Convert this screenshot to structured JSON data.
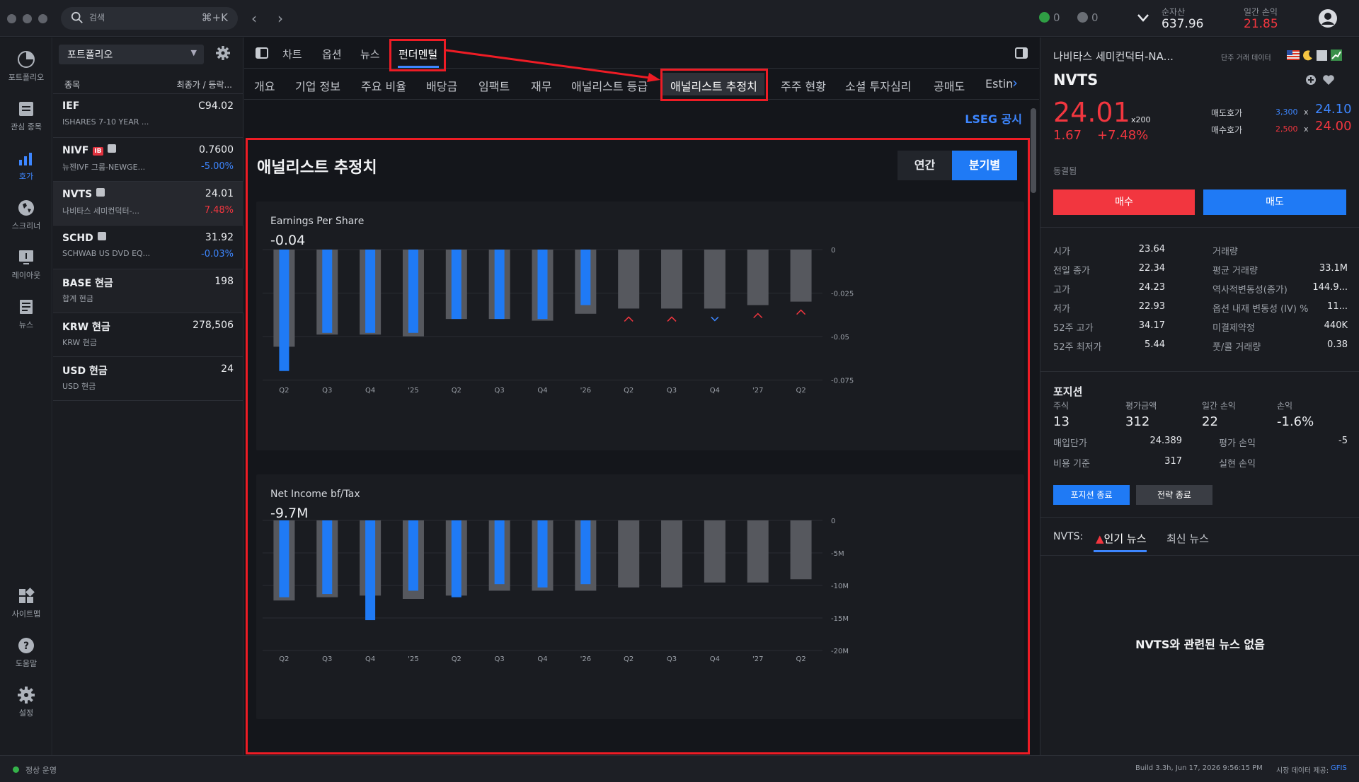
{
  "topbar": {
    "search_placeholder": "검색",
    "search_shortcut": "⌘+K",
    "notif_count_green": "0",
    "notif_count_gray": "0",
    "net_assets_label": "순자산",
    "net_assets_value": "637.96",
    "daily_pl_label": "일간 손익",
    "daily_pl_value": "21.85"
  },
  "rail": {
    "portfolio": "포트폴리오",
    "watchlist": "관심 종목",
    "quotes": "호가",
    "screener": "스크리너",
    "layout": "레이아웃",
    "news": "뉴스",
    "sitemap": "사이트맵",
    "help": "도움말",
    "settings": "설정"
  },
  "watchlist": {
    "selector": "포트폴리오",
    "col_symbol": "종목",
    "col_price": "최종가 / 등락...",
    "rows": [
      {
        "sym": "IEF",
        "name": "ISHARES 7-10 YEAR ...",
        "price": "C94.02",
        "change": ""
      },
      {
        "sym": "NIVF",
        "name": "뉴젠IVF 그룹-NEWGE...",
        "price": "0.7600",
        "change": "-5.00%"
      },
      {
        "sym": "NVTS",
        "name": "나비타스 세미컨덕터-...",
        "price": "24.01",
        "change": "7.48%"
      },
      {
        "sym": "SCHD",
        "name": "SCHWAB US DVD EQ...",
        "price": "31.92",
        "change": "-0.03%"
      },
      {
        "sym": "BASE 현금",
        "name": "합계 현금",
        "price": "198",
        "change": ""
      },
      {
        "sym": "KRW 현금",
        "name": "KRW 현금",
        "price": "278,506",
        "change": ""
      },
      {
        "sym": "USD 현금",
        "name": "USD 현금",
        "price": "24",
        "change": ""
      }
    ]
  },
  "main": {
    "tabs": [
      "차트",
      "옵션",
      "뉴스",
      "펀더멘털"
    ],
    "subtabs": [
      "개요",
      "기업 정보",
      "주요 비율",
      "배당금",
      "임팩트",
      "재무",
      "애널리스트 등급",
      "애널리스트 추정치",
      "주주 현황",
      "소셜 투자심리",
      "공매도",
      "Estim"
    ],
    "lseg_link": "LSEG 공시",
    "section_title": "애널리스트 추정치",
    "toggle_annual": "연간",
    "toggle_quarterly": "분기별",
    "eps_title": "Earnings Per Share",
    "eps_value": "-0.04",
    "ni_title": "Net Income bf/Tax",
    "ni_value": "-9.7M"
  },
  "chart_data": [
    {
      "type": "bar",
      "title": "Earnings Per Share",
      "categories": [
        "Q2",
        "Q3",
        "Q4",
        "'25",
        "Q2",
        "Q3",
        "Q4",
        "'26",
        "Q2",
        "Q3",
        "Q4",
        "'27",
        "Q2"
      ],
      "series": [
        {
          "name": "estimate",
          "values": [
            -0.056,
            -0.049,
            -0.049,
            -0.05,
            -0.04,
            -0.04,
            -0.041,
            -0.037,
            -0.034,
            -0.034,
            -0.034,
            -0.032,
            -0.03
          ]
        },
        {
          "name": "actual",
          "values": [
            -0.07,
            -0.048,
            -0.048,
            -0.048,
            -0.04,
            -0.04,
            -0.04,
            -0.032,
            null,
            null,
            null,
            null,
            null
          ]
        }
      ],
      "markers": [
        "",
        "",
        "",
        "",
        "",
        "",
        "",
        "",
        "up",
        "up",
        "down",
        "up",
        "up"
      ],
      "y_ticks": [
        "0",
        "-0.025",
        "-0.05",
        "-0.075"
      ],
      "ylim": [
        -0.075,
        0
      ],
      "colors": {
        "estimate": "#56585e",
        "actual": "#1f7af5",
        "up": "#f2363f",
        "down": "#3d86ff"
      }
    },
    {
      "type": "bar",
      "title": "Net Income bf/Tax",
      "categories": [
        "Q2",
        "Q3",
        "Q4",
        "'25",
        "Q2",
        "Q3",
        "Q4",
        "'26",
        "Q2",
        "Q3",
        "Q4",
        "'27",
        "Q2"
      ],
      "series": [
        {
          "name": "estimate",
          "values": [
            -24.5,
            -23.5,
            -23.0,
            -24.0,
            -23.0,
            -21.5,
            -21.5,
            -21.5,
            -20.5,
            -20.5,
            -19.0,
            -19.0,
            -18.0
          ]
        },
        {
          "name": "actual",
          "values": [
            -23.5,
            -22.5,
            -30.5,
            -21.5,
            -23.5,
            -19.5,
            -20.5,
            -19.5,
            null,
            null,
            null,
            null,
            null
          ]
        }
      ],
      "y_ticks": [
        "0",
        "-5M",
        "-10M",
        "-15M",
        "-20M"
      ],
      "ylim": [
        -40,
        0
      ],
      "colors": {
        "estimate": "#56585e",
        "actual": "#1f7af5"
      }
    }
  ],
  "right": {
    "company": "나비타스 세미컨덕터-NA...",
    "label": "단주 거래 데이터",
    "symbol": "NVTS",
    "price": "24.01",
    "multiplier": "x200",
    "change": "1.67",
    "change_pct": "+7.48%",
    "ask_label": "매도호가",
    "ask_size": "3,300",
    "ask_price": "24.10",
    "bid_label": "매수호가",
    "bid_size": "2,500",
    "bid_price": "24.00",
    "lock_label": "동결됨",
    "buy": "매수",
    "sell": "매도",
    "stats_left": [
      {
        "k": "시가",
        "v": "23.64"
      },
      {
        "k": "전일 종가",
        "v": "22.34"
      },
      {
        "k": "고가",
        "v": "24.23"
      },
      {
        "k": "저가",
        "v": "22.93"
      },
      {
        "k": "52주 고가",
        "v": "34.17"
      },
      {
        "k": "52주 최저가",
        "v": "5.44"
      }
    ],
    "stats_right": [
      {
        "k": "거래량",
        "v": ""
      },
      {
        "k": "평균 거래량",
        "v": "33.1M"
      },
      {
        "k": "역사적변동성(종가)",
        "v": "144.9..."
      },
      {
        "k": "옵션 내재 변동성 (IV) %",
        "v": "11..."
      },
      {
        "k": "미결제약정",
        "v": "440K"
      },
      {
        "k": "풋/콜 거래량",
        "v": "0.38"
      }
    ],
    "position_title": "포지션",
    "pos_cols": [
      "주식",
      "평가금액",
      "일간 손익",
      "손익"
    ],
    "pos_vals": [
      "13",
      "312",
      "22",
      "-1.6%"
    ],
    "avg_cost_label": "매입단가",
    "avg_cost": "24.389",
    "unreal_label": "평가 손익",
    "unreal": "-5",
    "cost_basis_label": "비용 기준",
    "cost_basis": "317",
    "real_label": "실현 손익",
    "real": "",
    "close_pos_btn": "포지션 종료",
    "close_strat_btn": "전략 종료",
    "news_sym": "NVTS:",
    "news_tab_hot": "인기 뉴스",
    "news_tab_latest": "최신 뉴스",
    "news_empty": "NVTS와 관련된 뉴스 없음"
  },
  "status": {
    "state": "정상 운영",
    "build": "Build 3.3h, Jun 17, 2026 9:56:15 PM",
    "data_label": "시장 데이터 제공:",
    "data_provider": "GFIS"
  }
}
